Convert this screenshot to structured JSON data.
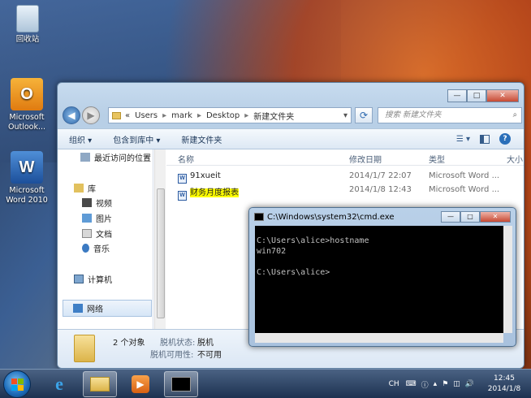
{
  "desktop": {
    "icons": [
      {
        "label": "回收站"
      },
      {
        "label": "Microsoft Outlook..."
      },
      {
        "label": "Microsoft Word 2010"
      }
    ]
  },
  "explorer": {
    "window_buttons": {
      "minimize": "—",
      "maximize": "□",
      "close": "✕"
    },
    "back": "◀",
    "forward": "▶",
    "breadcrumb": [
      "«",
      "Users",
      "▸",
      "mark",
      "▸",
      "Desktop",
      "▸",
      "新建文件夹"
    ],
    "address_dropdown": "▾",
    "refresh": "⟳",
    "search_placeholder": "搜索 新建文件夹",
    "toolbar": {
      "organize": "组织 ▾",
      "include_in_library": "包含到库中 ▾",
      "new_folder": "新建文件夹"
    },
    "sidebar": {
      "recent": "最近访问的位置",
      "libraries": "库",
      "videos": "视频",
      "pictures": "图片",
      "documents": "文档",
      "music": "音乐",
      "computer": "计算机",
      "network": "网络"
    },
    "columns": {
      "name": "名称",
      "modified": "修改日期",
      "type": "类型",
      "size": "大小"
    },
    "files": [
      {
        "name": "91xueit",
        "modified": "2014/1/7 22:07",
        "type": "Microsoft Word ...",
        "highlight": false
      },
      {
        "name": "财务月度报表",
        "modified": "2014/1/8 12:43",
        "type": "Microsoft Word ...",
        "highlight": true
      }
    ],
    "details": {
      "count": "2 个对象",
      "offline_status_label": "脱机状态:",
      "offline_status": "脱机",
      "offline_avail_label": "脱机可用性:",
      "offline_avail": "不可用"
    }
  },
  "cmd": {
    "title": "C:\\Windows\\system32\\cmd.exe",
    "buttons": {
      "minimize": "—",
      "maximize": "□",
      "close": "✕"
    },
    "output": "C:\\Users\\alice>hostname\nwin702\n\nC:\\Users\\alice>"
  },
  "taskbar": {
    "tray": {
      "lang": "CH",
      "time": "12:45",
      "date": "2014/1/8"
    }
  },
  "colors": {
    "accent": "#2a6fb9",
    "highlight": "#ffff00"
  }
}
